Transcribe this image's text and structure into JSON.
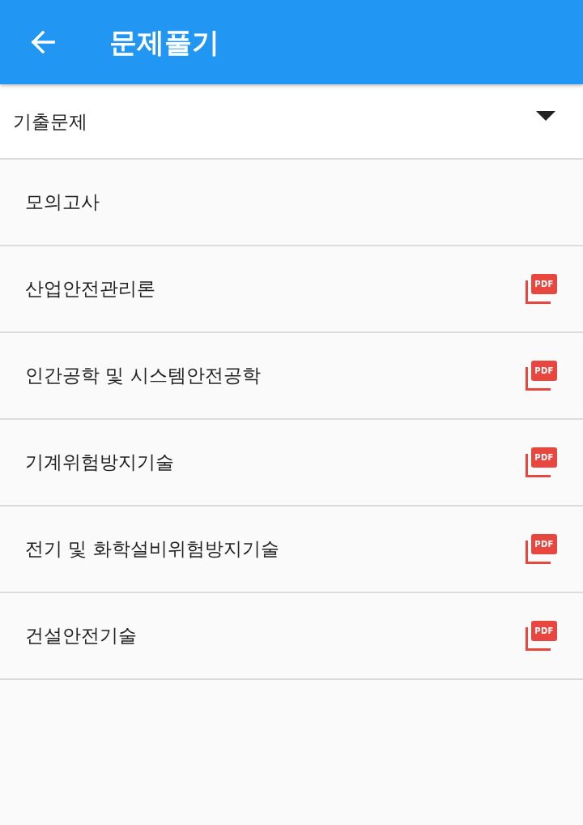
{
  "app_bar": {
    "title": "문제풀기"
  },
  "dropdown": {
    "value": "기출문제"
  },
  "items": [
    {
      "label": "모의고사"
    },
    {
      "label": "산업안전관리론",
      "pdf": "PDF"
    },
    {
      "label": "인간공학 및 시스템안전공학",
      "pdf": "PDF"
    },
    {
      "label": "기계위험방지기술",
      "pdf": "PDF"
    },
    {
      "label": "전기 및 화학설비위험방지기술",
      "pdf": "PDF"
    },
    {
      "label": "건설안전기술",
      "pdf": "PDF"
    }
  ]
}
